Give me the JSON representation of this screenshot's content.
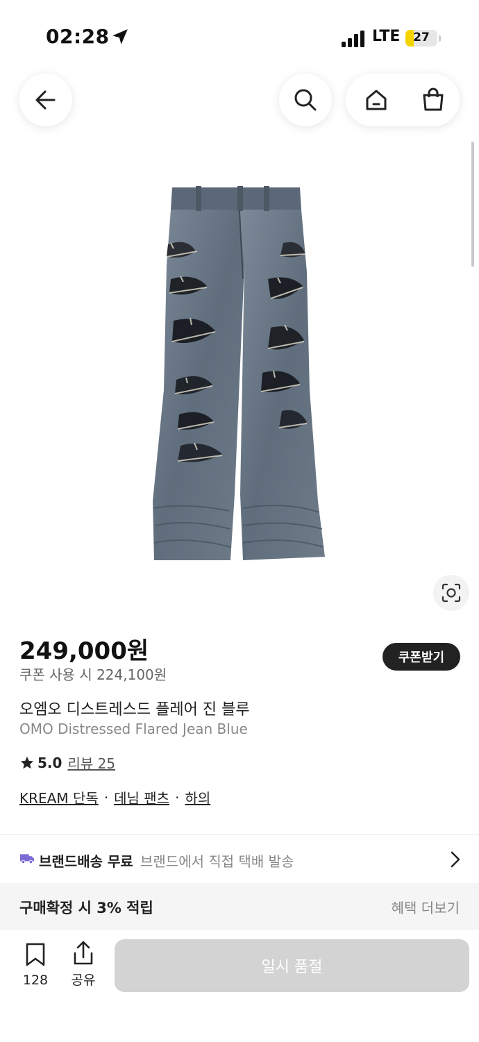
{
  "status_bar": {
    "time": "02:28",
    "network": "LTE",
    "battery": "27",
    "battery_level": 0.27,
    "battery_color": "#f5d400"
  },
  "nav": {
    "icons": [
      "arrow-left-icon",
      "search-icon",
      "home-icon",
      "shopping-bag-icon"
    ]
  },
  "product": {
    "price": "249,000원",
    "coupon_price": "쿠폰 사용 시 224,100원",
    "coupon_button": "쿠폰받기",
    "name_ko": "오엠오 디스트레스드 플레어 진 블루",
    "name_en": "OMO Distressed Flared Jean Blue",
    "rating": "5.0",
    "review": "리뷰 25",
    "tags": [
      "KREAM 단독",
      "데님 팬츠",
      "하의"
    ]
  },
  "delivery": {
    "label": "브랜드배송 무료",
    "description": "브랜드에서 직접 택배 발송",
    "truck_color": "#7b6bd6"
  },
  "benefit": {
    "label": "구매확정 시 3% 적립",
    "more": "혜택 더보기"
  },
  "bottom_bar": {
    "wish_count": "128",
    "share_label": "공유",
    "buy_label": "일시 품절"
  }
}
